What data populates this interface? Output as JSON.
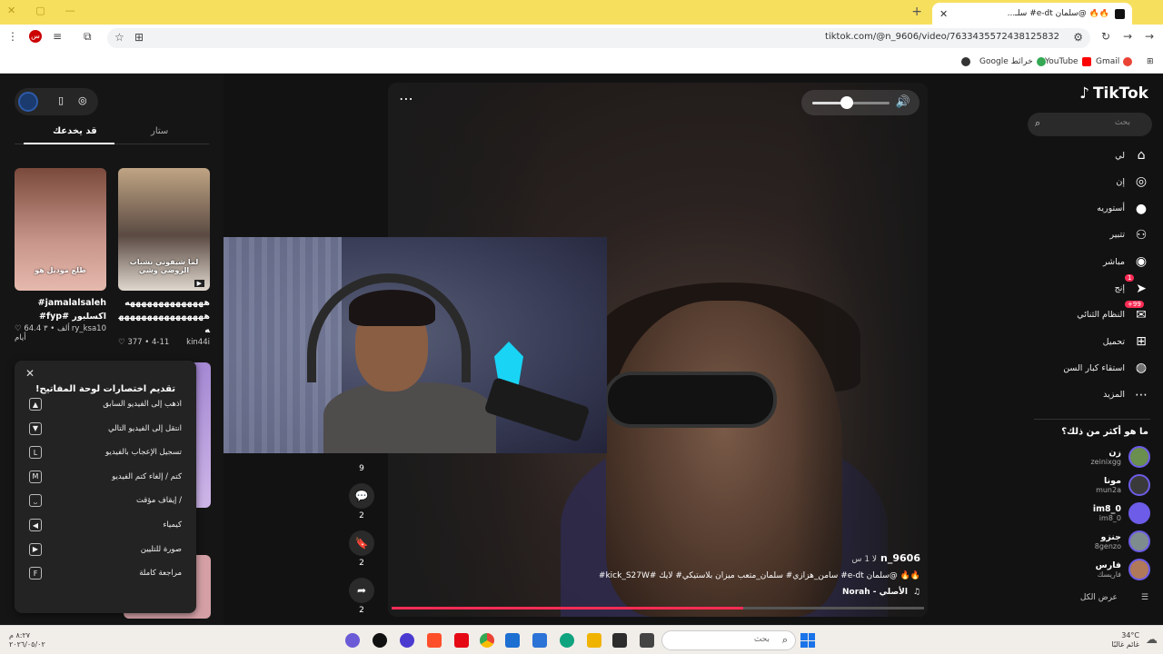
{
  "browser": {
    "tab_title": "🔥🔥 @سلمان e-dt# سلـ...",
    "url": "tiktok.com/@n_9606/video/7633435572438125832",
    "bookmarks": [
      "Gmail",
      "YouTube",
      "خرائط Google"
    ]
  },
  "tiktok": {
    "logo": "TikTok",
    "search_placeholder": "بحث",
    "nav": [
      {
        "label": "لي",
        "icon": "home-icon"
      },
      {
        "label": "إن",
        "icon": "compass-icon"
      },
      {
        "label": "أستوريه",
        "icon": "avatar-icon"
      },
      {
        "label": "تتبير",
        "icon": "users-icon"
      },
      {
        "label": "مباشر",
        "icon": "live-icon"
      },
      {
        "label": "إنج",
        "icon": "send-icon",
        "badge": "1"
      },
      {
        "label": "النظام الثنائي",
        "icon": "inbox-icon",
        "badge": "99+"
      },
      {
        "label": "تحميل",
        "icon": "plus-icon"
      },
      {
        "label": "استقاء كبار السن",
        "icon": "globe-icon"
      },
      {
        "label": "المزيد",
        "icon": "more-icon"
      }
    ],
    "following_header": "ما هو أكثر من ذلك؟",
    "accounts": [
      {
        "name": "زن",
        "handle": "zeinixgg"
      },
      {
        "name": "مونا",
        "handle": "mun2a"
      },
      {
        "name": "im8_0",
        "handle": "im8_0"
      },
      {
        "name": "جنزو",
        "handle": "8genzo"
      },
      {
        "name": "فارس",
        "handle": "فاريسك"
      }
    ],
    "see_all": "عرض الكل"
  },
  "video": {
    "username": "n_9606",
    "time": "لا 1 س",
    "caption": "🔥🔥 @سلمان e-dt# سامن_هزازي# سلمان_متعب ميزان بلاستيكي# لايك #kick_S27W#",
    "music_label": "الأصلي - Norah",
    "progress": 0.66,
    "volume": 0.45
  },
  "actions": [
    {
      "icon": "comment-icon",
      "count": "9"
    },
    {
      "icon": "chat-icon",
      "count": "2"
    },
    {
      "icon": "bookmark-icon",
      "count": "2"
    },
    {
      "icon": "share-icon",
      "count": "2"
    }
  ],
  "left_panel": {
    "tabs": [
      "ستار",
      "قد يخدعك"
    ],
    "cards": [
      {
        "caption": "#jamalalsaleh #fyp# اكسلبور",
        "author": "ry_ksa10",
        "likes": "64.4 ألف",
        "age": "٣ أيام",
        "overlay": "طلع موديل هو"
      },
      {
        "caption": "ههههههههههههههه ههههههههههههههههه",
        "author": "kin44i",
        "likes": "377",
        "age": "4-11",
        "overlay": "لما شيفوني نشباب الروضي وشي"
      }
    ]
  },
  "shortcuts": {
    "title": "تقديم اختصارات لوحة المفاتيح!",
    "items": [
      {
        "label": "اذهب إلى الفيديو السابق",
        "key": "▲"
      },
      {
        "label": "انتقل إلى الفيديو التالي",
        "key": "▼"
      },
      {
        "label": "تسجيل الإعجاب بالفيديو",
        "key": "L"
      },
      {
        "label": "كتم / إلغاء كتم الفيديو",
        "key": "M"
      },
      {
        "label": "/ إيقاف مؤقت",
        "key": "⎵"
      },
      {
        "label": "كيمياء",
        "key": "◀"
      },
      {
        "label": "صورة للتليين",
        "key": "▶"
      },
      {
        "label": "مراجعة كاملة",
        "key": "F"
      }
    ]
  },
  "taskbar": {
    "search": "بحث",
    "weather_temp": "34°C",
    "weather_desc": "غائم غالبًا",
    "time": "٨:٢٧ م",
    "date": "٢٠٢٦/٠٥/٠٢"
  }
}
